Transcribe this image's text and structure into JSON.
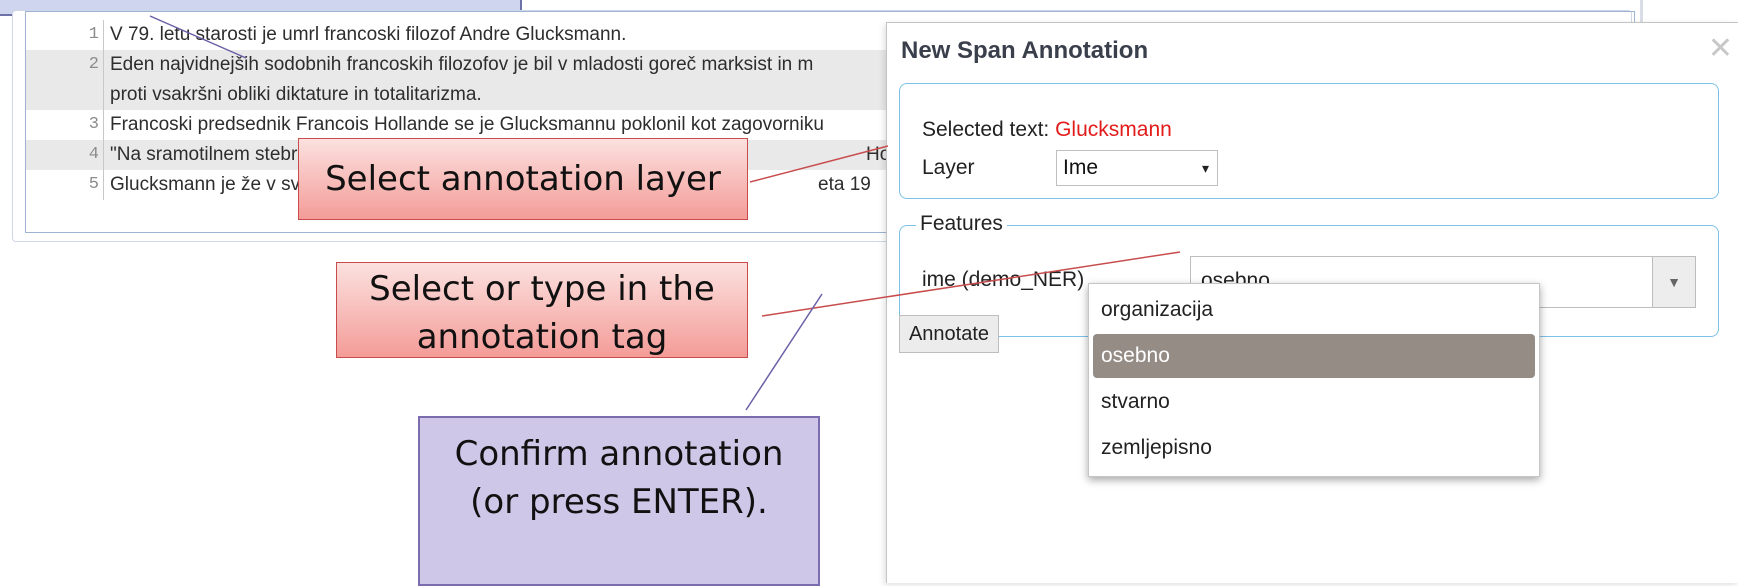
{
  "sentences": [
    {
      "num": "1",
      "text": "V 79. letu starosti je umrl francoski filozof Andre Glucksmann."
    },
    {
      "num": "2",
      "text": "Eden najvidnejših sodobnih francoskih filozofov je bil v mladosti goreč marksist in m"
    },
    {
      "num": "",
      "text": "proti vsakršni obliki diktature in totalitarizma."
    },
    {
      "num": "3",
      "text": "Francoski predsednik Francois Hollande se je Glucksmannu poklonil kot zagovorniku"
    },
    {
      "num": "4",
      "text": "\"Na sramotilnem stebru"
    },
    {
      "num": "5",
      "text": "Glucksmann je že v svoj"
    }
  ],
  "partial_fragments": {
    "row4_right": "Hollar",
    "row5_right": "eta 19"
  },
  "dialog": {
    "title": "New Span Annotation",
    "close_glyph": "✕",
    "selected_text_label": "Selected text:",
    "selected_text_value": "Glucksmann",
    "layer_label": "Layer",
    "layer_value": "Ime",
    "layer_arrow": "▾",
    "features_legend": "Features",
    "feature_label": "ime (demo_NER)",
    "feature_value": "osebno",
    "combo_arrow": "▼",
    "annotate_button": "Annotate"
  },
  "dropdown_options": [
    {
      "label": "organizacija",
      "selected": false
    },
    {
      "label": "osebno",
      "selected": true
    },
    {
      "label": "stvarno",
      "selected": false
    },
    {
      "label": "zemljepisno",
      "selected": false
    }
  ],
  "callouts": {
    "layer": "Select annotation layer",
    "tag_line1": "Select or type in the",
    "tag_line2": "annotation tag",
    "confirm_line1": "Confirm annotation",
    "confirm_line2": "(or press ENTER)."
  },
  "colors": {
    "selected_text": "#e21b1b",
    "callout_red": "#f49c98",
    "callout_purple": "#cfc7e8",
    "selected_option": "#958c86"
  }
}
